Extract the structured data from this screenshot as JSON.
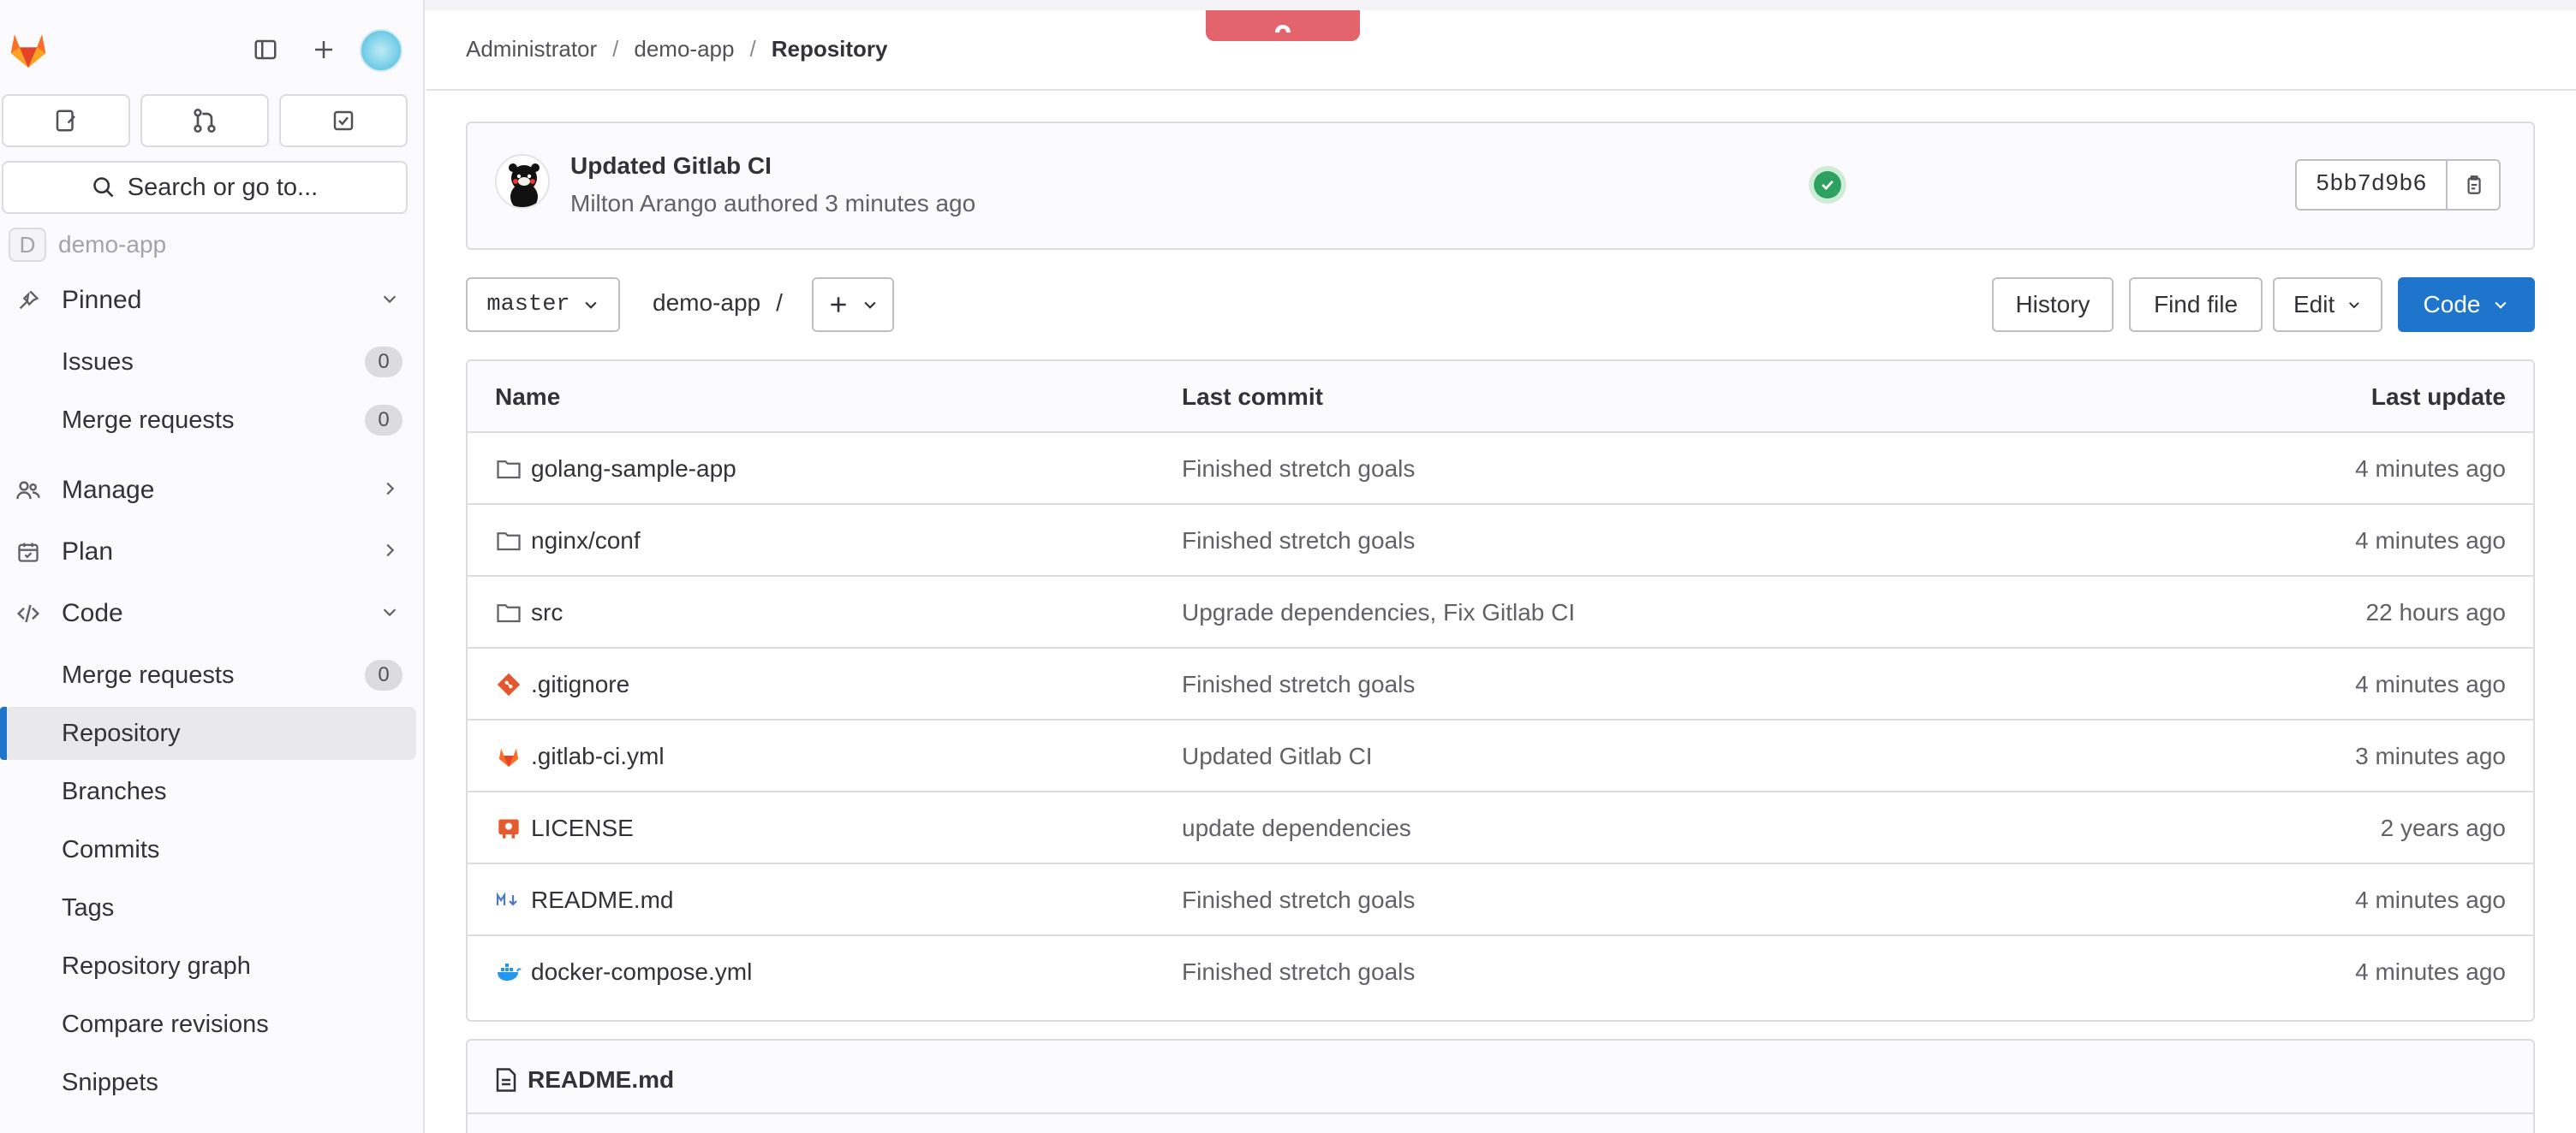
{
  "sidebar": {
    "search_label": "Search or go to...",
    "project_faded": {
      "initial": "D",
      "name": "demo-app"
    },
    "pinned": {
      "label": "Pinned",
      "items": [
        {
          "label": "Issues",
          "count": "0"
        },
        {
          "label": "Merge requests",
          "count": "0"
        }
      ]
    },
    "manage_label": "Manage",
    "plan_label": "Plan",
    "code": {
      "label": "Code",
      "items": [
        {
          "label": "Merge requests",
          "count": "0"
        },
        {
          "label": "Repository"
        },
        {
          "label": "Branches"
        },
        {
          "label": "Commits"
        },
        {
          "label": "Tags"
        },
        {
          "label": "Repository graph"
        },
        {
          "label": "Compare revisions"
        },
        {
          "label": "Snippets"
        }
      ]
    }
  },
  "breadcrumb": {
    "items": [
      "Administrator",
      "demo-app",
      "Repository"
    ]
  },
  "commit": {
    "title": "Updated Gitlab CI",
    "meta": "Milton Arango authored 3 minutes ago",
    "sha": "5bb7d9b6",
    "pipeline_status": "passed"
  },
  "toolbar": {
    "branch": "master",
    "path": "demo-app",
    "path_sep": "/",
    "history": "History",
    "find_file": "Find file",
    "edit": "Edit",
    "code": "Code"
  },
  "table": {
    "headers": {
      "name": "Name",
      "last_commit": "Last commit",
      "last_update": "Last update"
    },
    "rows": [
      {
        "icon": "folder-icon",
        "name": "golang-sample-app",
        "commit": "Finished stretch goals",
        "updated": "4 minutes ago"
      },
      {
        "icon": "folder-icon",
        "name": "nginx/conf",
        "commit": "Finished stretch goals",
        "updated": "4 minutes ago"
      },
      {
        "icon": "folder-icon",
        "name": "src",
        "commit": "Upgrade dependencies, Fix Gitlab CI",
        "updated": "22 hours ago"
      },
      {
        "icon": "git-icon",
        "name": ".gitignore",
        "commit": "Finished stretch goals",
        "updated": "4 minutes ago"
      },
      {
        "icon": "gitlab-icon",
        "name": ".gitlab-ci.yml",
        "commit": "Updated Gitlab CI",
        "updated": "3 minutes ago"
      },
      {
        "icon": "license-icon",
        "name": "LICENSE",
        "commit": "update dependencies",
        "updated": "2 years ago"
      },
      {
        "icon": "markdown-icon",
        "name": "README.md",
        "commit": "Finished stretch goals",
        "updated": "4 minutes ago"
      },
      {
        "icon": "docker-icon",
        "name": "docker-compose.yml",
        "commit": "Finished stretch goals",
        "updated": "4 minutes ago"
      }
    ]
  },
  "readme": {
    "title": "README.md"
  },
  "colors": {
    "accent": "#1f75cb",
    "success": "#2da160",
    "brand": "#e24329"
  }
}
